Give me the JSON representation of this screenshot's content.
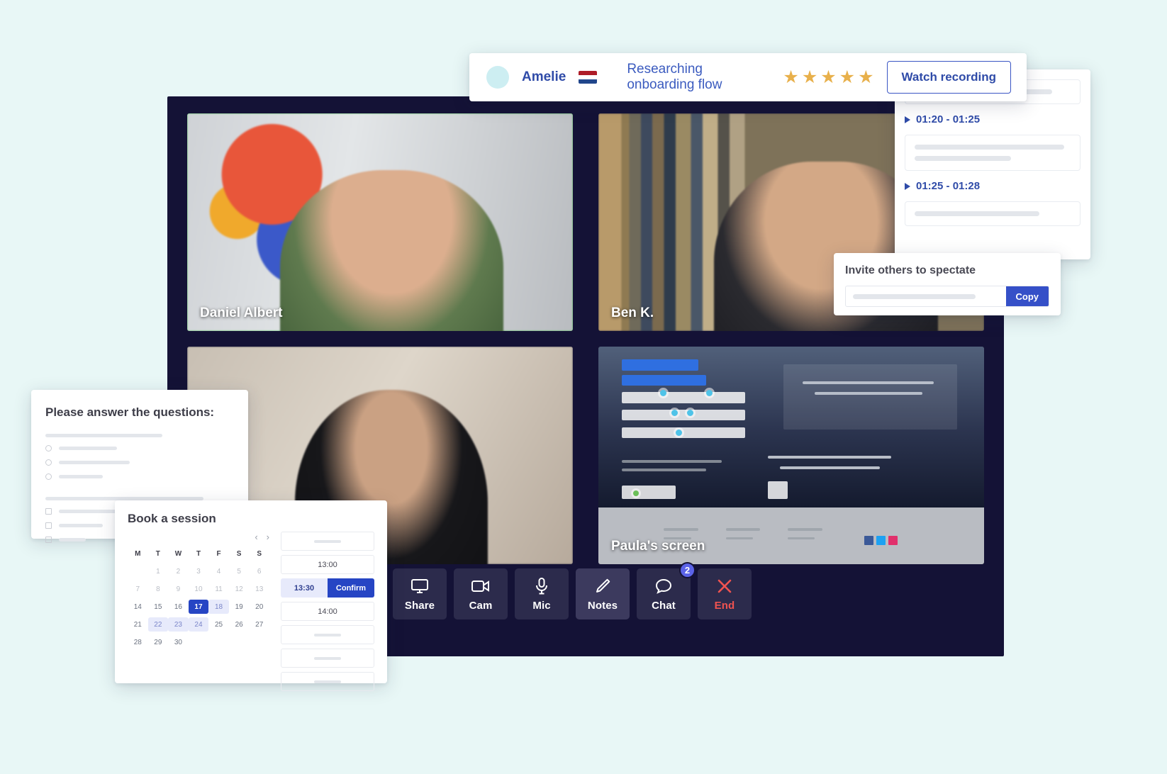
{
  "session_bar": {
    "participant_name": "Amelie",
    "flag": "nl-flag-icon",
    "session_title": "Researching onboarding flow",
    "rating": 5,
    "star_glyph": "★",
    "watch_label": "Watch recording",
    "accent": "#2f4ba8"
  },
  "transcript": {
    "entries": [
      {
        "time": "01:20 - 01:25"
      },
      {
        "time": "01:25 - 01:28"
      }
    ]
  },
  "invite": {
    "title": "Invite others to spectate",
    "copy_label": "Copy",
    "button_color": "#3550c8"
  },
  "tiles": [
    {
      "name": "Daniel Albert",
      "active": true
    },
    {
      "name": "Ben K.",
      "active": false
    },
    {
      "name": "",
      "active": false
    },
    {
      "name": "Paula's screen",
      "active": false
    }
  ],
  "controls": [
    {
      "label": "Share",
      "icon": "monitor-icon",
      "state": "off",
      "badge": ""
    },
    {
      "label": "Cam",
      "icon": "video-camera-icon",
      "state": "off",
      "badge": ""
    },
    {
      "label": "Mic",
      "icon": "microphone-icon",
      "state": "off",
      "badge": ""
    },
    {
      "label": "Notes",
      "icon": "pencil-icon",
      "state": "on",
      "badge": ""
    },
    {
      "label": "Chat",
      "icon": "chat-bubble-icon",
      "state": "off",
      "badge": "2"
    },
    {
      "label": "End",
      "icon": "close-x-icon",
      "state": "end",
      "badge": ""
    }
  ],
  "questions": {
    "title": "Please answer the questions:",
    "radio_options": 3,
    "checkbox_options": 3
  },
  "booking": {
    "title": "Book a session",
    "prev_glyph": "‹",
    "next_glyph": "›",
    "weekdays": [
      "M",
      "T",
      "W",
      "T",
      "F",
      "S",
      "S"
    ],
    "leading_blanks": 1,
    "days": [
      1,
      2,
      3,
      4,
      5,
      6,
      7,
      8,
      9,
      10,
      11,
      12,
      13,
      14,
      15,
      16,
      17,
      18,
      19,
      20,
      21,
      22,
      23,
      24,
      25,
      26,
      27,
      28,
      29,
      30
    ],
    "selected_day": 17,
    "soft_days": [
      18,
      22,
      23,
      24
    ],
    "slots": [
      {
        "label": "",
        "type": "skeleton"
      },
      {
        "label": "13:00",
        "type": "time"
      },
      {
        "label": "13:30",
        "type": "selected",
        "confirm_label": "Confirm"
      },
      {
        "label": "14:00",
        "type": "time"
      },
      {
        "label": "",
        "type": "skeleton"
      },
      {
        "label": "",
        "type": "skeleton"
      },
      {
        "label": "",
        "type": "skeleton"
      }
    ]
  },
  "theme": {
    "page_background": "#e8f7f6",
    "window_background": "#141236",
    "active_tile_outline": "#3fc04a",
    "badge_color": "#5b63e8",
    "end_color": "#ef5350"
  }
}
